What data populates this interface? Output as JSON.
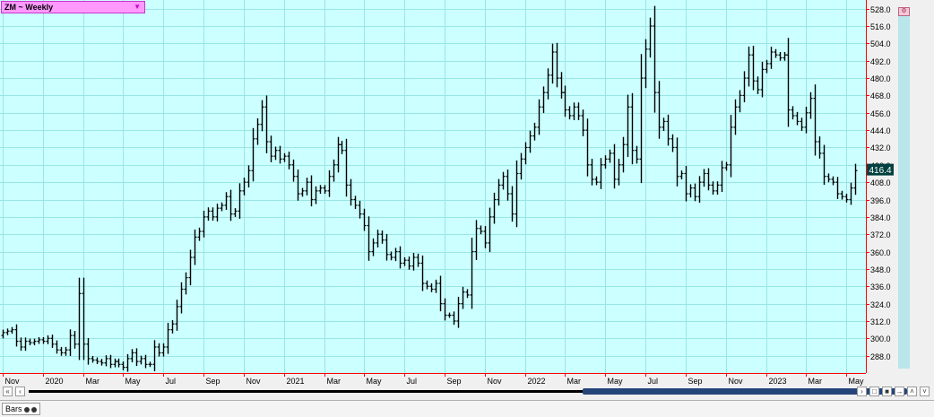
{
  "symbol": "ZM ~ Weekly",
  "last_price": "416.4",
  "status_tab": "Bars",
  "colors": {
    "background": "#ccffff",
    "grid": "#99e6e6",
    "bars": "#000000",
    "axis": "#ff0000",
    "price_tag": "#004040"
  },
  "chart_data": {
    "type": "bar",
    "title": "ZM ~ Weekly",
    "bar_style": "OHLC",
    "ylim": [
      276,
      534
    ],
    "y_ticks": [
      288,
      300,
      312,
      324,
      336,
      348,
      360,
      372,
      384,
      396,
      408,
      420,
      432,
      444,
      456,
      468,
      480,
      492,
      504,
      516,
      528
    ],
    "y_tick_labels": [
      "288.0",
      "300.0",
      "312.0",
      "324.0",
      "336.0",
      "348.0",
      "360.0",
      "372.0",
      "384.0",
      "396.0",
      "408.0",
      "420.0",
      "432.0",
      "444.0",
      "456.0",
      "468.0",
      "480.0",
      "492.0",
      "504.0",
      "516.0",
      "528.0"
    ],
    "x_labels": [
      "Nov",
      "2020",
      "Mar",
      "May",
      "Jul",
      "Sep",
      "Nov",
      "2021",
      "Mar",
      "May",
      "Jul",
      "Sep",
      "Nov",
      "2022",
      "Mar",
      "May",
      "Jul",
      "Sep",
      "Nov",
      "2023",
      "Mar",
      "May"
    ],
    "x_label_positions": [
      0,
      9,
      18,
      27,
      36,
      45,
      54,
      63,
      72,
      81,
      90,
      99,
      108,
      117,
      126,
      135,
      144,
      153,
      162,
      171,
      180,
      189
    ],
    "grid": true,
    "last": 416.4,
    "closes": [
      304,
      305,
      306,
      298,
      294,
      298,
      297,
      298,
      299,
      298,
      300,
      296,
      292,
      290,
      292,
      302,
      296,
      331,
      296,
      286,
      285,
      284,
      283,
      286,
      282,
      284,
      282,
      280,
      286,
      290,
      284,
      286,
      282,
      282,
      294,
      290,
      294,
      306,
      310,
      322,
      334,
      342,
      356,
      370,
      374,
      384,
      388,
      384,
      390,
      392,
      398,
      386,
      388,
      402,
      408,
      416,
      438,
      448,
      460,
      436,
      426,
      430,
      424,
      426,
      420,
      412,
      400,
      402,
      408,
      396,
      402,
      404,
      402,
      412,
      420,
      434,
      430,
      406,
      396,
      392,
      386,
      378,
      360,
      366,
      372,
      368,
      358,
      356,
      360,
      352,
      354,
      350,
      356,
      352,
      338,
      336,
      334,
      338,
      324,
      316,
      316,
      312,
      324,
      332,
      330,
      360,
      376,
      374,
      366,
      384,
      396,
      406,
      412,
      400,
      386,
      414,
      424,
      432,
      440,
      446,
      460,
      470,
      482,
      498,
      480,
      470,
      458,
      454,
      460,
      454,
      444,
      420,
      410,
      408,
      420,
      424,
      428,
      410,
      420,
      434,
      460,
      430,
      424,
      480,
      500,
      516,
      470,
      446,
      450,
      438,
      432,
      412,
      414,
      400,
      404,
      398,
      408,
      414,
      406,
      402,
      406,
      418,
      420,
      446,
      460,
      468,
      480,
      496,
      478,
      472,
      486,
      490,
      498,
      496,
      494,
      496,
      458,
      454,
      450,
      446,
      456,
      466,
      436,
      428,
      412,
      410,
      408,
      400,
      398,
      396,
      404,
      416
    ]
  }
}
